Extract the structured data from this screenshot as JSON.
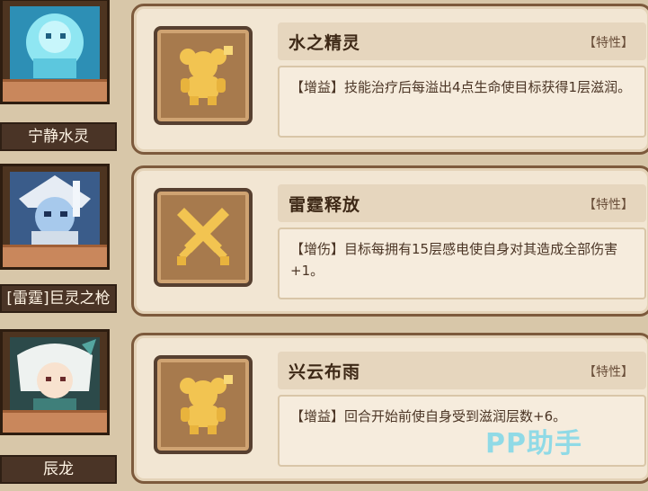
{
  "entries": [
    {
      "name": "宁静水灵",
      "portrait_icon": "water-spirit-portrait",
      "trait_icon": "bear-buff-icon",
      "title": "水之精灵",
      "tag": "【特性】",
      "description": "【增益】技能治疗后每溢出4点生命使目标获得1层滋润。"
    },
    {
      "name": "[雷霆]巨灵之枪",
      "portrait_icon": "thunder-giant-portrait",
      "trait_icon": "crossed-swords-icon",
      "title": "雷霆释放",
      "tag": "【特性】",
      "description": "【增伤】目标每拥有15层感电使自身对其造成全部伤害+1。"
    },
    {
      "name": "辰龙",
      "portrait_icon": "dragon-girl-portrait",
      "trait_icon": "bear-buff-icon",
      "title": "兴云布雨",
      "tag": "【特性】",
      "description": "【增益】回合开始前使自身受到滋润层数+6。"
    }
  ],
  "watermark": "PP助手",
  "colors": {
    "background": "#d8c7a9",
    "card": "#f2e6d3",
    "icon_gold": "#f2c451"
  }
}
